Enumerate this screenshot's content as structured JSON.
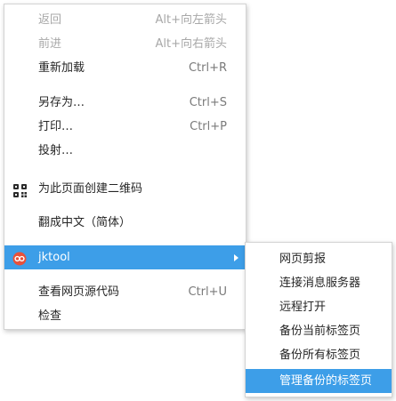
{
  "menu": {
    "back": {
      "label": "返回",
      "shortcut": "Alt+向左箭头"
    },
    "forward": {
      "label": "前进",
      "shortcut": "Alt+向右箭头"
    },
    "reload": {
      "label": "重新加载",
      "shortcut": "Ctrl+R"
    },
    "save_as": {
      "label": "另存为…",
      "shortcut": "Ctrl+S"
    },
    "print": {
      "label": "打印…",
      "shortcut": "Ctrl+P"
    },
    "cast": {
      "label": "投射…"
    },
    "qr_code": {
      "label": "为此页面创建二维码",
      "icon": "qr-code-icon"
    },
    "translate": {
      "label": "翻成中文（简体）"
    },
    "jktool": {
      "label": "jktool",
      "icon": "jktool-extension-icon"
    },
    "view_source": {
      "label": "查看网页源代码",
      "shortcut": "Ctrl+U"
    },
    "inspect": {
      "label": "检查"
    }
  },
  "submenu": {
    "items": [
      {
        "label": "网页剪报"
      },
      {
        "label": "连接消息服务器"
      },
      {
        "label": "远程打开"
      },
      {
        "label": "备份当前标签页"
      },
      {
        "label": "备份所有标签页"
      },
      {
        "label": "管理备份的标签页"
      }
    ]
  },
  "colors": {
    "highlight": "#3d9ee8",
    "text": "#262626",
    "disabled_text": "#a8a8a8",
    "shortcut_text": "#7a7a7a",
    "jktool_icon": "#e8503a"
  }
}
